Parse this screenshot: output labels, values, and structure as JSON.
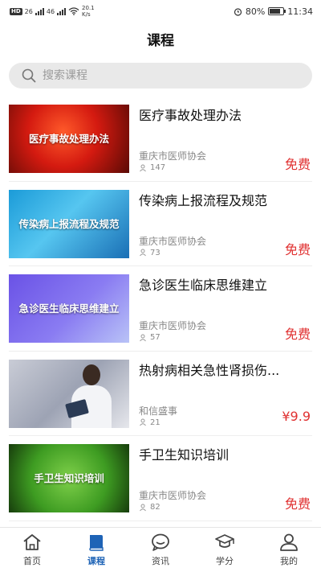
{
  "status_bar": {
    "left": [
      "HD",
      "26",
      "46",
      "20.1",
      "K/s"
    ],
    "battery_percent": "80%",
    "time": "11:34"
  },
  "header": {
    "title": "课程"
  },
  "search": {
    "placeholder": "搜索课程"
  },
  "courses": [
    {
      "thumb_text": "医疗事故处理办法",
      "title": "医疗事故处理办法",
      "org": "重庆市医师协会",
      "views": "147",
      "price": "免费"
    },
    {
      "thumb_text": "传染病上报流程及规范",
      "title": "传染病上报流程及规范",
      "org": "重庆市医师协会",
      "views": "73",
      "price": "免费"
    },
    {
      "thumb_text": "急诊医生临床思维建立",
      "title": "急诊医生临床思维建立",
      "org": "重庆市医师协会",
      "views": "57",
      "price": "免费"
    },
    {
      "thumb_text": "",
      "title": "热射病相关急性肾损伤...",
      "org": "和信盛事",
      "views": "21",
      "price": "¥9.9"
    },
    {
      "thumb_text": "手卫生知识培训",
      "title": "手卫生知识培训",
      "org": "重庆市医师协会",
      "views": "82",
      "price": "免费"
    }
  ],
  "tabs": [
    {
      "label": "首页",
      "icon": "home-icon"
    },
    {
      "label": "课程",
      "icon": "book-icon",
      "active": true
    },
    {
      "label": "资讯",
      "icon": "chat-icon"
    },
    {
      "label": "学分",
      "icon": "graduation-cap-icon"
    },
    {
      "label": "我的",
      "icon": "user-icon"
    }
  ],
  "colors": {
    "accent": "#1e63b6",
    "price": "#e03131"
  }
}
